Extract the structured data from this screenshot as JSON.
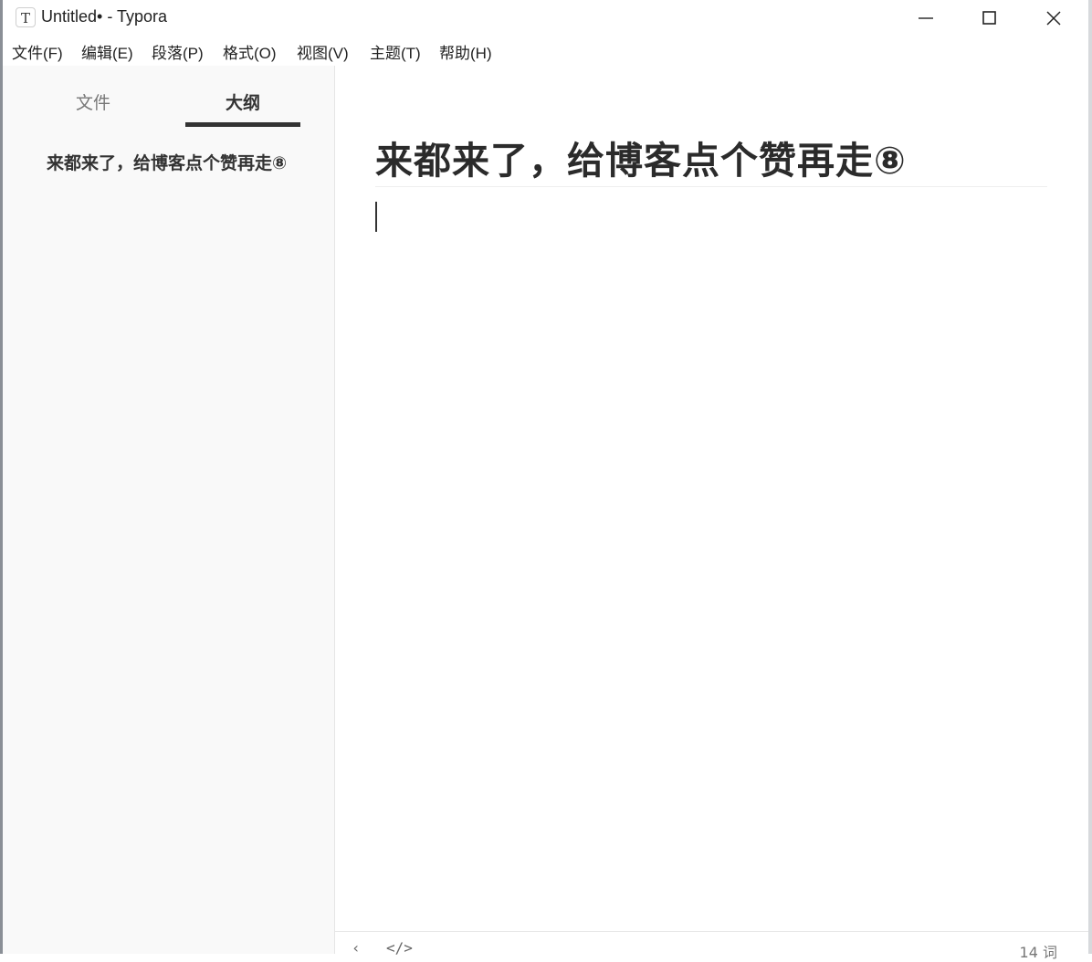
{
  "window": {
    "app_icon_glyph": "T",
    "title": "Untitled• - Typora"
  },
  "menubar": {
    "items": [
      "文件(F)",
      "编辑(E)",
      "段落(P)",
      "格式(O)",
      "视图(V)",
      "主题(T)",
      "帮助(H)"
    ]
  },
  "sidebar": {
    "tabs": [
      {
        "label": "文件",
        "active": false
      },
      {
        "label": "大纲",
        "active": true
      }
    ],
    "outline": [
      {
        "text": "来都来了，给博客点个赞再走⑧",
        "level": 1
      }
    ]
  },
  "editor": {
    "heading": "来都来了，给博客点个赞再走⑧"
  },
  "statusbar": {
    "left_icon_1": "‹",
    "left_icon_2": "</>",
    "word_count": "14 词"
  },
  "colors": {
    "sidebar_bg": "#f9f9f9",
    "text": "#333333",
    "active_tab_underline": "#333333"
  },
  "icons": [
    "typora-app-icon",
    "minimize-icon",
    "maximize-icon",
    "close-icon",
    "toggle-sidebar-icon",
    "source-code-icon"
  ]
}
